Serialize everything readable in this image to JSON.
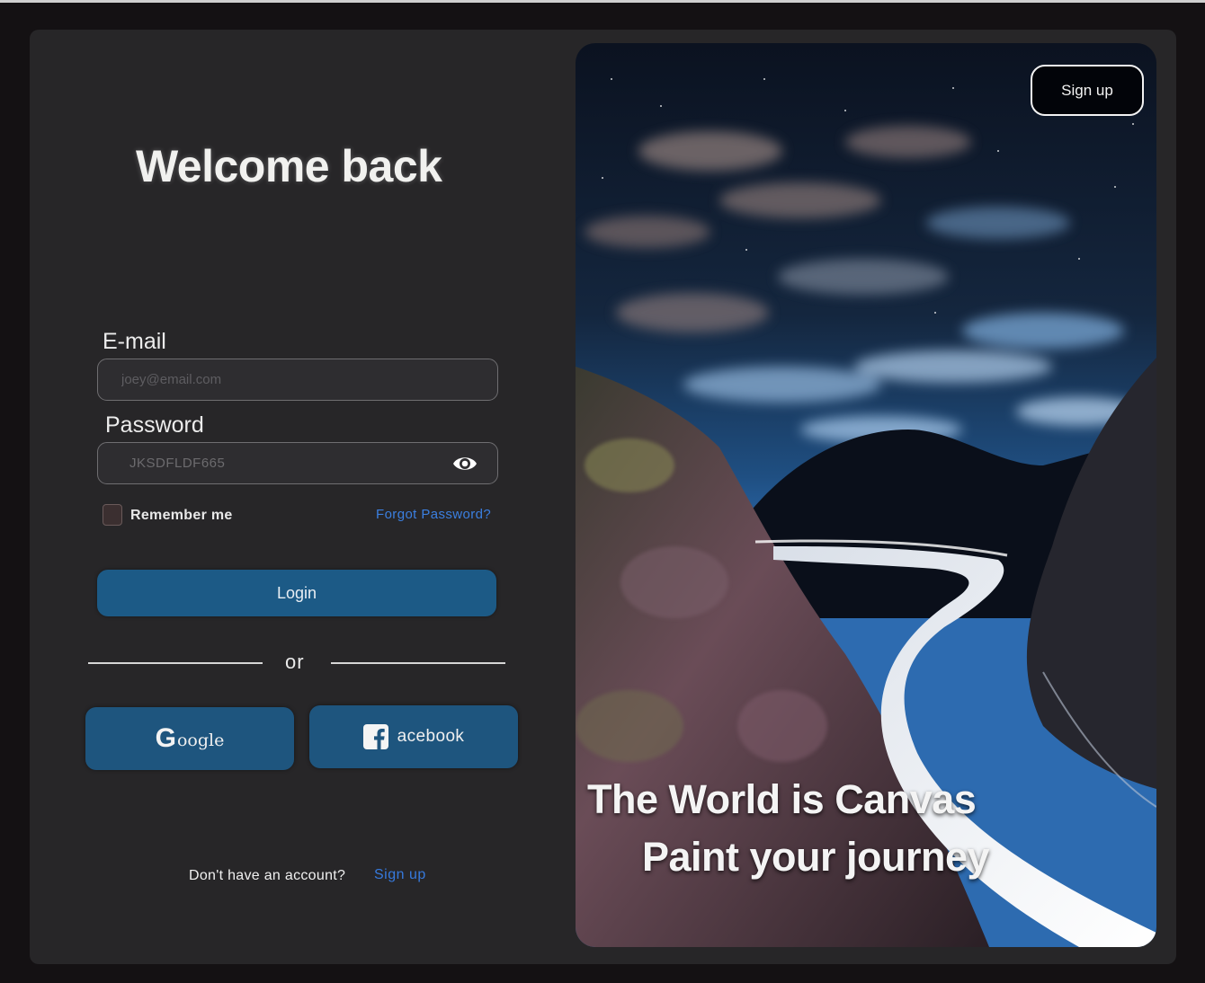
{
  "login": {
    "title": "Welcome back",
    "email_label": "E-mail",
    "email_placeholder": "joey@email.com",
    "password_label": "Password",
    "password_value": "JKSDFLDF665",
    "remember_label": "Remember me",
    "forgot_label": "Forgot Password?",
    "login_label": "Login",
    "or_label": "or",
    "google_label": "G",
    "google_text": "oogle",
    "facebook_text": "acebook",
    "no_account_text": "Don't have an account?",
    "signup_link": "Sign up"
  },
  "hero": {
    "signup_button": "Sign up",
    "tagline_line1": "The World is Canvas",
    "tagline_line2": "Paint  your journey"
  },
  "colors": {
    "page_bg": "#141113",
    "card_bg": "#272628",
    "primary_button": "#1c5a86",
    "link": "#3b7fe0"
  },
  "icons": [
    "eye-icon",
    "facebook-icon"
  ]
}
